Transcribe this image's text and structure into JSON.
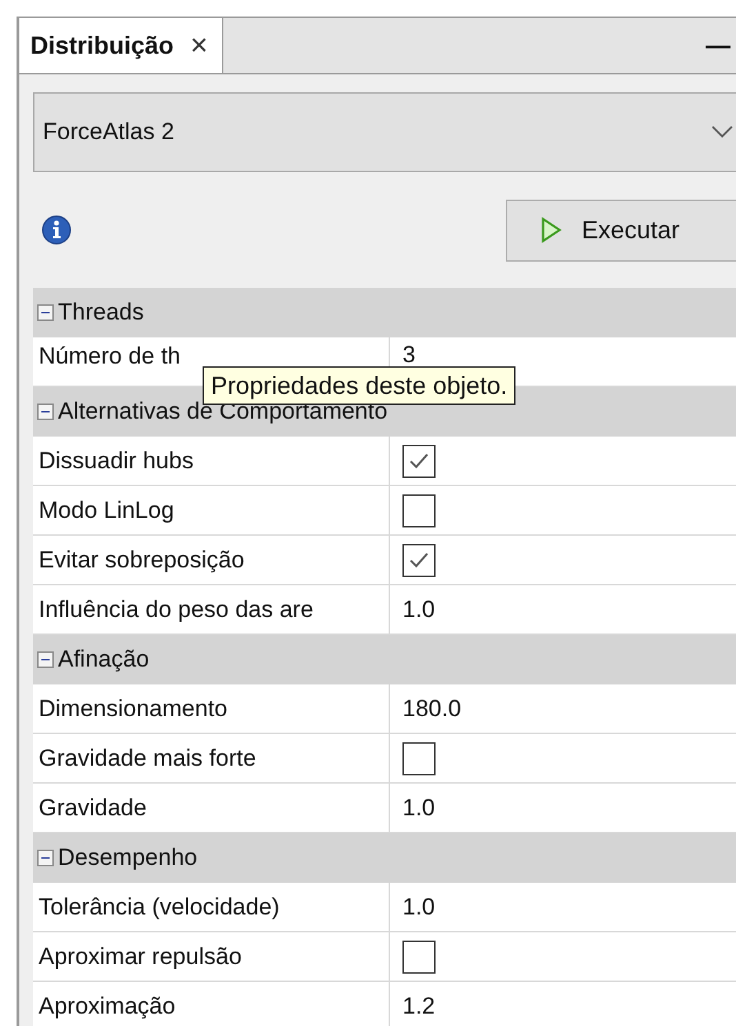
{
  "tab": {
    "label": "Distribuição",
    "close": "×",
    "selected": true
  },
  "minimize": "—",
  "layout_select": {
    "value": "ForceAtlas 2"
  },
  "run_button": {
    "label": "Executar"
  },
  "sections": [
    {
      "title": "Threads",
      "expanded": true,
      "properties": [
        {
          "kind": "text",
          "name": "Número de th",
          "value": "3"
        }
      ]
    },
    {
      "title": "Alternativas de Comportamento",
      "expanded": true,
      "properties": [
        {
          "kind": "checkbox",
          "name": "Dissuadir hubs",
          "checked": true
        },
        {
          "kind": "checkbox",
          "name": "Modo LinLog",
          "checked": false
        },
        {
          "kind": "checkbox",
          "name": "Evitar sobreposição",
          "checked": true
        },
        {
          "kind": "text",
          "name": "Influência do peso das are",
          "value": "1.0"
        }
      ]
    },
    {
      "title": "Afinação",
      "expanded": true,
      "properties": [
        {
          "kind": "text",
          "name": "Dimensionamento",
          "value": "180.0"
        },
        {
          "kind": "checkbox",
          "name": "Gravidade mais forte",
          "checked": false
        },
        {
          "kind": "text",
          "name": "Gravidade",
          "value": "1.0"
        }
      ]
    },
    {
      "title": "Desempenho",
      "expanded": true,
      "properties": [
        {
          "kind": "text",
          "name": "Tolerância (velocidade)",
          "value": "1.0"
        },
        {
          "kind": "checkbox",
          "name": "Aproximar repulsão",
          "checked": false
        },
        {
          "kind": "text",
          "name": "Aproximação",
          "value": "1.2"
        }
      ]
    }
  ],
  "tooltip": {
    "text": "Propriedades deste objeto."
  }
}
